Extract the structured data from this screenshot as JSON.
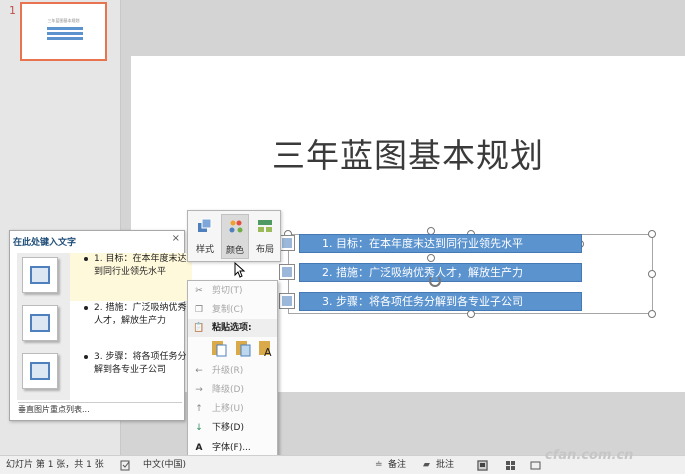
{
  "thumbnail": {
    "slide_number": "1",
    "title": "三年蓝图基本规划"
  },
  "slide": {
    "title": "三年蓝图基本规划",
    "bullets": [
      "1. 目标：在本年度末达到同行业领先水平",
      "2. 措施：广泛吸纳优秀人才，解放生产力",
      "3. 步骤：将各项任务分解到各专业子公司"
    ]
  },
  "text_pane": {
    "header": "在此处键入文字",
    "close": "×",
    "items": [
      "1. 目标：在本年度末达到同行业领先水平",
      "2. 措施：广泛吸纳优秀人才，解放生产力",
      "3. 步骤：将各项任务分解到各专业子公司"
    ],
    "footer": "垂直图片重点列表..."
  },
  "mini_toolbar": {
    "style_label": "样式",
    "color_label": "颜色",
    "layout_label": "布局"
  },
  "context_menu": {
    "cut": "剪切(T)",
    "copy": "复制(C)",
    "paste_options": "粘贴选项:",
    "promote": "升级(R)",
    "demote": "降级(D)",
    "move_up": "上移(U)",
    "move_down": "下移(D)",
    "font": "字体(F)..."
  },
  "status_bar": {
    "slide_info": "幻灯片 第 1 张，共 1 张",
    "language": "中文(中国)",
    "notes": "备注",
    "comments": "批注"
  },
  "watermark": "cfan.com.cn",
  "colors": {
    "accent_blue": "#5b93cf",
    "thumb_border": "#e8734f",
    "slide_number": "#c0504d"
  }
}
